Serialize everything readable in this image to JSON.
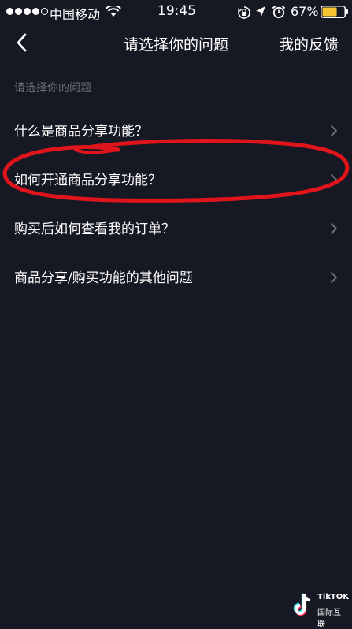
{
  "status_bar": {
    "carrier": "中国移动",
    "time": "19:45",
    "battery_percent": "67%",
    "battery_level": 0.67,
    "signal_bars": 4,
    "signal_total": 5
  },
  "nav": {
    "title": "请选择你的问题",
    "feedback_label": "我的反馈",
    "back_icon": "chevron-left-icon"
  },
  "section_header": "请选择你的问题",
  "questions": [
    {
      "label": "什么是商品分享功能？"
    },
    {
      "label": "如何开通商品分享功能？"
    },
    {
      "label": "购买后如何查看我的订单？"
    },
    {
      "label": "商品分享/购买功能的其他问题"
    }
  ],
  "annotation": {
    "color": "#e0141b",
    "highlighted_question": "如何开通商品分享功能？"
  },
  "watermark": {
    "line1": "TikTOK",
    "line2": "国际互联"
  },
  "colors": {
    "background": "#161823",
    "text": "#ffffff",
    "muted": "#6b6d78",
    "chevron": "#7a7c86"
  }
}
